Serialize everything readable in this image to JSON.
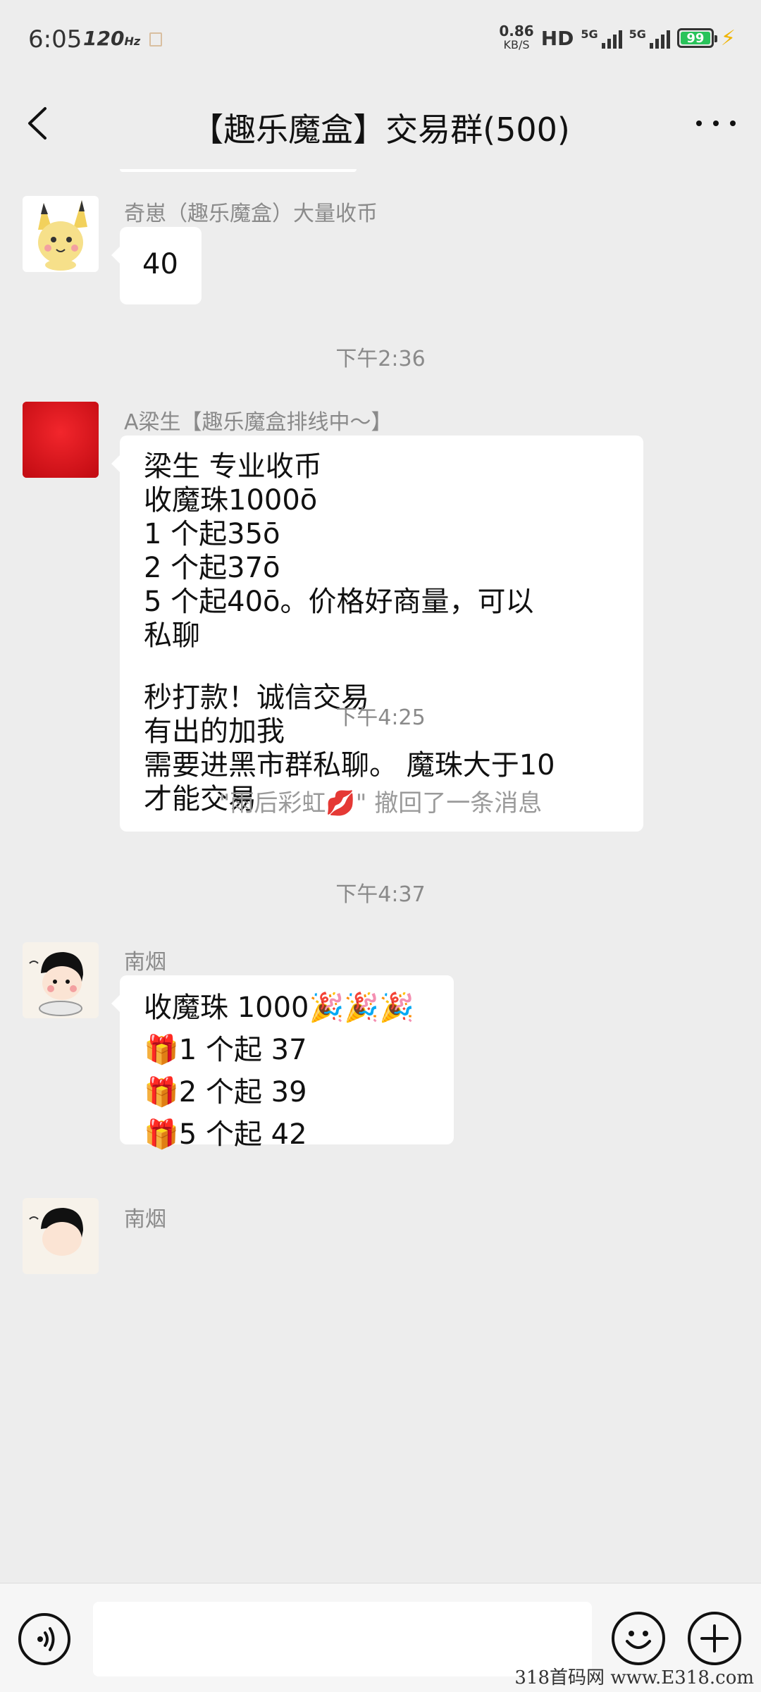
{
  "status_bar": {
    "time": "6:05",
    "refresh_rate": "120",
    "refresh_unit": "Hz",
    "net_speed_value": "0.86",
    "net_speed_unit": "KB/S",
    "hd_label": "HD",
    "signal_1_label": "5G",
    "signal_2_label": "5G",
    "battery_level": "99"
  },
  "header": {
    "title": "【趣乐魔盒】交易群(500)"
  },
  "messages": [
    {
      "sender": "奇崽（趣乐魔盒）大量收币",
      "lines": [
        "40"
      ]
    },
    {
      "timestamp": "下午2:36"
    },
    {
      "sender": "A梁生【趣乐魔盒排线中～】",
      "lines": [
        "梁生 专业收币",
        "收魔珠1000ō",
        "1 个起35ō",
        "2 个起37ō",
        "5 个起40ō。价格好商量，可以",
        "私聊",
        "",
        "秒打款！诚信交易",
        "有出的加我",
        "需要进黑市群私聊。 魔珠大于10",
        "才能交易"
      ]
    },
    {
      "timestamp": "下午4:25"
    },
    {
      "system": "\"雨后彩虹💋\" 撤回了一条消息"
    },
    {
      "timestamp": "下午4:37"
    },
    {
      "sender": "南烟",
      "lines": [
        "收魔珠 1000🎉🎉🎉",
        "🎁1 个起 37",
        "🎁2 个起 39",
        "🎁5 个起 42"
      ]
    },
    {
      "sender": "南烟"
    }
  ],
  "input_bar": {
    "input_value": "",
    "voice_icon": "voice-icon",
    "emoji_icon": "emoji-icon",
    "plus_icon": "plus-icon"
  },
  "watermark": "318首码网 www.E318.com"
}
